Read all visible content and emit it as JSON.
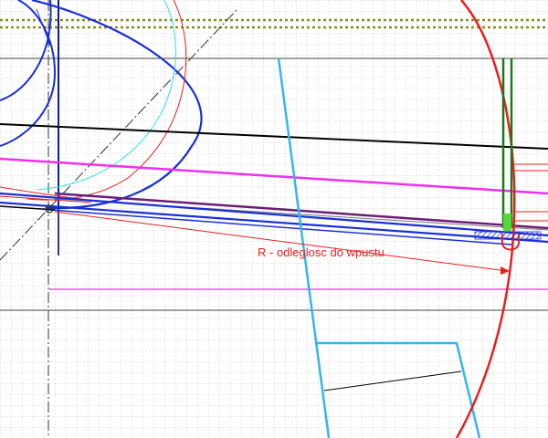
{
  "annotation": {
    "label": "R - odleglosc do wpustu"
  },
  "colors": {
    "background": "#ffffff",
    "grid": "#b9b9b9",
    "hatch_band": "#8a8a1a",
    "frame": "#444444",
    "black_line": "#000000",
    "blue": "#1a2fd6",
    "dark_blue": "#0a1aa8",
    "cyan": "#36b6e8",
    "light_cyan": "#39e0e0",
    "red": "#e81f1f",
    "magenta": "#ef2fef",
    "purple": "#6a1d78",
    "green": "#1a7a1a",
    "light_green": "#58d63a",
    "dashdot": "#333333"
  }
}
